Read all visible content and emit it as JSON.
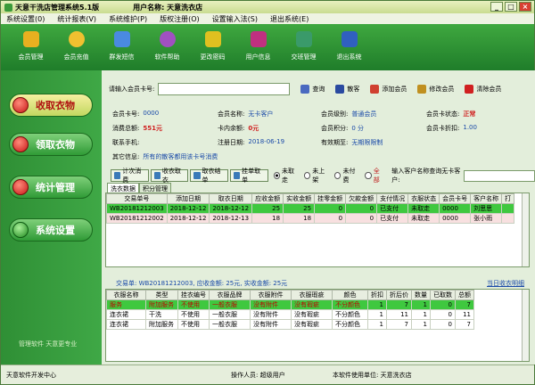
{
  "window": {
    "title": "天意干洗店管理系统5.1版",
    "user_label": "用户名称: 天意洗衣店"
  },
  "menu": [
    "系统设置(0)",
    "统计报表(V)",
    "系统维护(P)",
    "版权注册(O)",
    "设置输入法(S)",
    "退出系统(E)"
  ],
  "toolbar": [
    {
      "label": "会员管理",
      "color": "#e8b020"
    },
    {
      "label": "会员充值",
      "color": "#f0c030"
    },
    {
      "label": "群发短信",
      "color": "#4a8ae0"
    },
    {
      "label": "软件帮助",
      "color": "#a050c0"
    },
    {
      "label": "更改密码",
      "color": "#e0c020"
    },
    {
      "label": "用户信息",
      "color": "#c03080"
    },
    {
      "label": "交班管理",
      "color": "#3a9a6a"
    },
    {
      "label": "退出系统",
      "color": "#3060c0"
    }
  ],
  "sidebar": {
    "items": [
      "收取衣物",
      "领取衣物",
      "统计管理",
      "系统设置"
    ],
    "footer": "管理软件  天意更专业"
  },
  "search": {
    "label": "请输入会员卡号:",
    "value": "",
    "buttons": [
      "查询",
      "散客",
      "添加会员",
      "修改会员",
      "清除会员"
    ]
  },
  "member": {
    "card_no_label": "会员卡号:",
    "card_no": "0000",
    "name_label": "会员名称:",
    "name": "无卡客户",
    "level_label": "会员级别:",
    "level": "普通会员",
    "status_label": "会员卡状态:",
    "status": "正常",
    "spend_label": "消费总额:",
    "spend": "551元",
    "balance_label": "卡内余额:",
    "balance": "0元",
    "points_label": "会员积分:",
    "points": "0 分",
    "discount_label": "会员卡折扣:",
    "discount": "1.00",
    "phone_label": "联系手机:",
    "phone": "",
    "reg_label": "注册日期:",
    "reg": "2018-06-19",
    "expire_label": "有效期至:",
    "expire": "无期限限制",
    "other_label": "其它信息:",
    "other": "所有的散客都用该卡号消费"
  },
  "actions": {
    "buttons": [
      "计次消费",
      "收衣取衣",
      "取衣结单",
      "挂单取单"
    ],
    "radios": [
      "未取走",
      "未上架",
      "未付费",
      "全部"
    ],
    "selected_radio": 0,
    "search_label": "输入客户名称查询无卡客户:"
  },
  "tabs": [
    "洗衣数据",
    "积分管理"
  ],
  "orders": {
    "headers": [
      "交易单号",
      "添加日期",
      "取衣日期",
      "应收金额",
      "实收金额",
      "挂零金额",
      "欠款金额",
      "支付情况",
      "衣服状态",
      "会员卡号",
      "客户名称",
      "打"
    ],
    "rows": [
      [
        "WB20181212003",
        "2018-12-12",
        "2018-12-12",
        "25",
        "25",
        "0",
        "0",
        "已支付",
        "未取走",
        "0000",
        "刘思思",
        ""
      ],
      [
        "WB20181212002",
        "2018-12-12",
        "2018-12-13",
        "18",
        "18",
        "0",
        "0",
        "已支付",
        "未取走",
        "0000",
        "张小雨",
        ""
      ]
    ]
  },
  "trade": {
    "line": "交易单: WB20181212003, 应收金额: 25元, 实收金额: 25元",
    "link": "当日收衣明细"
  },
  "items": {
    "headers": [
      "衣服名称",
      "类型",
      "挂衣编号",
      "衣服品牌",
      "衣服附件",
      "衣服瑕疵",
      "颜色",
      "折扣",
      "折后价",
      "数量",
      "已取数",
      "总额"
    ],
    "rows": [
      [
        "服务",
        "附加服务",
        "不使用",
        "一般衣服",
        "没有附件",
        "没有瑕疵",
        "不分颜色",
        "1",
        "7",
        "1",
        "0",
        "7"
      ],
      [
        "连衣裙",
        "干洗",
        "不使用",
        "一般衣服",
        "没有附件",
        "没有瑕疵",
        "不分颜色",
        "1",
        "11",
        "1",
        "0",
        "11"
      ],
      [
        "连衣裙",
        "附加服务",
        "不使用",
        "一般衣服",
        "没有附件",
        "没有瑕疵",
        "不分颜色",
        "1",
        "7",
        "1",
        "0",
        "7"
      ]
    ]
  },
  "status": {
    "left": "天意软件开发中心",
    "operator": "操作人员: 超级用户",
    "unit": "本软件使用单位: 天意洗衣店"
  }
}
